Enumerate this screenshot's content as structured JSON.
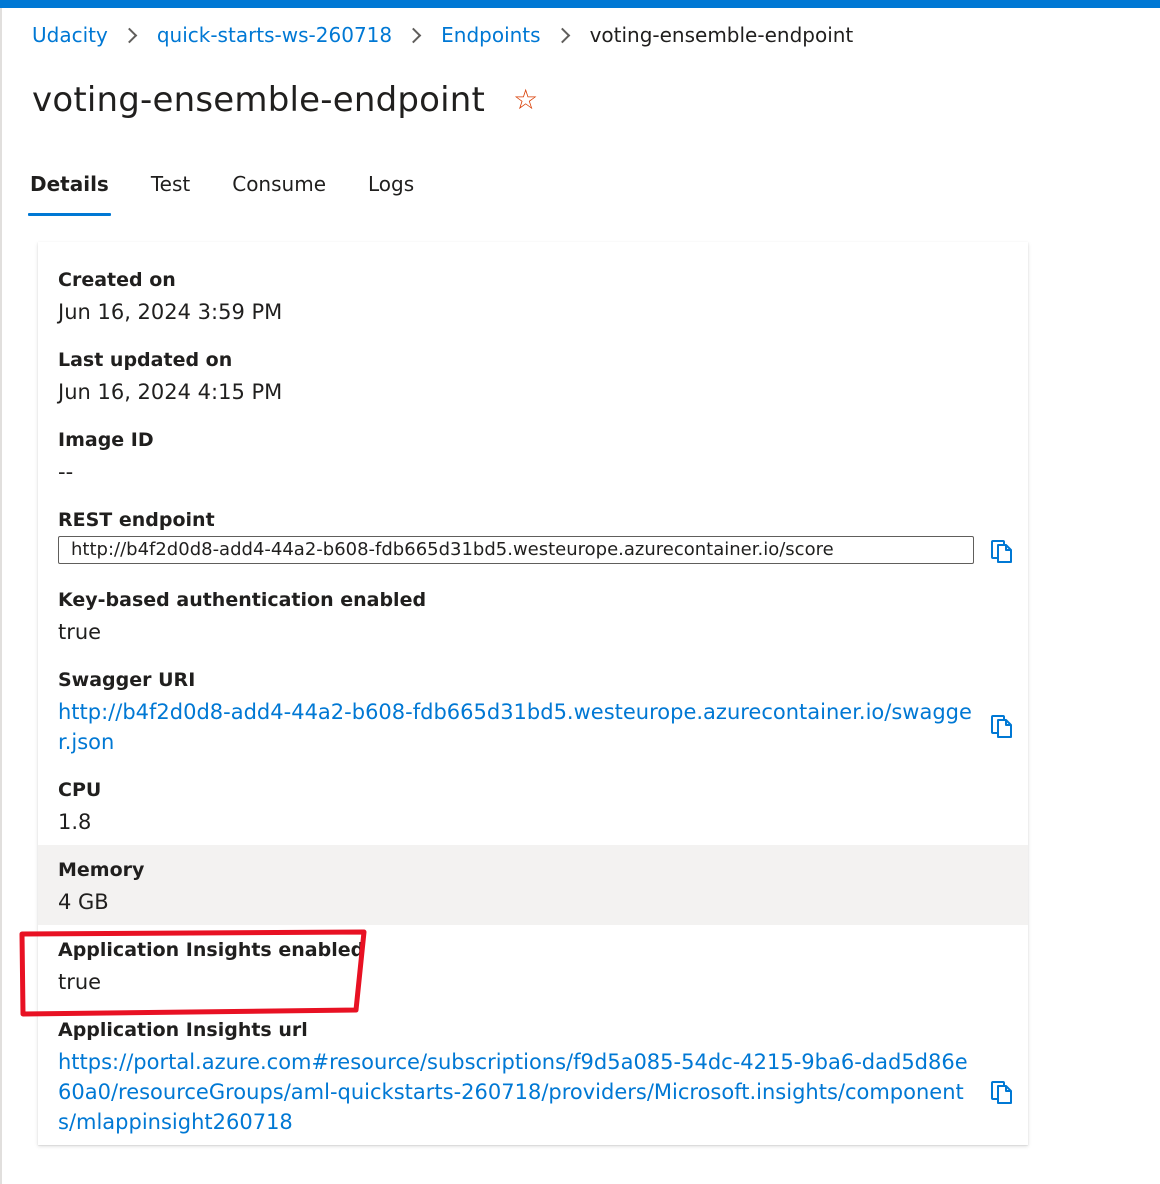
{
  "breadcrumb": {
    "items": [
      "Udacity",
      "quick-starts-ws-260718",
      "Endpoints"
    ],
    "current": "voting-ensemble-endpoint"
  },
  "page": {
    "title": "voting-ensemble-endpoint",
    "favorite_icon": "star-icon"
  },
  "tabs": [
    "Details",
    "Test",
    "Consume",
    "Logs"
  ],
  "active_tab": "Details",
  "details": {
    "created_on": {
      "label": "Created on",
      "value": "Jun 16, 2024 3:59 PM"
    },
    "last_updated_on": {
      "label": "Last updated on",
      "value": "Jun 16, 2024 4:15 PM"
    },
    "image_id": {
      "label": "Image ID",
      "value": "--"
    },
    "rest_endpoint": {
      "label": "REST endpoint",
      "value": "http://b4f2d0d8-add4-44a2-b608-fdb665d31bd5.westeurope.azurecontainer.io/score"
    },
    "key_auth": {
      "label": "Key-based authentication enabled",
      "value": "true"
    },
    "swagger_uri": {
      "label": "Swagger URI",
      "value": "http://b4f2d0d8-add4-44a2-b608-fdb665d31bd5.westeurope.azurecontainer.io/swagger.json"
    },
    "cpu": {
      "label": "CPU",
      "value": "1.8"
    },
    "memory": {
      "label": "Memory",
      "value": "4 GB"
    },
    "app_insights_enabled": {
      "label": "Application Insights enabled",
      "value": "true"
    },
    "app_insights_url": {
      "label": "Application Insights url",
      "value": "https://portal.azure.com#resource/subscriptions/f9d5a085-54dc-4215-9ba6-dad5d86e60a0/resourceGroups/aml-quickstarts-260718/providers/Microsoft.insights/components/mlappinsight260718"
    }
  },
  "colors": {
    "accent": "#0078d4",
    "star": "#d83b01",
    "annotation": "#e81123",
    "hover_row": "#f3f2f1"
  },
  "icons": {
    "copy": "copy-icon",
    "chevron": "chevron-right-icon"
  }
}
